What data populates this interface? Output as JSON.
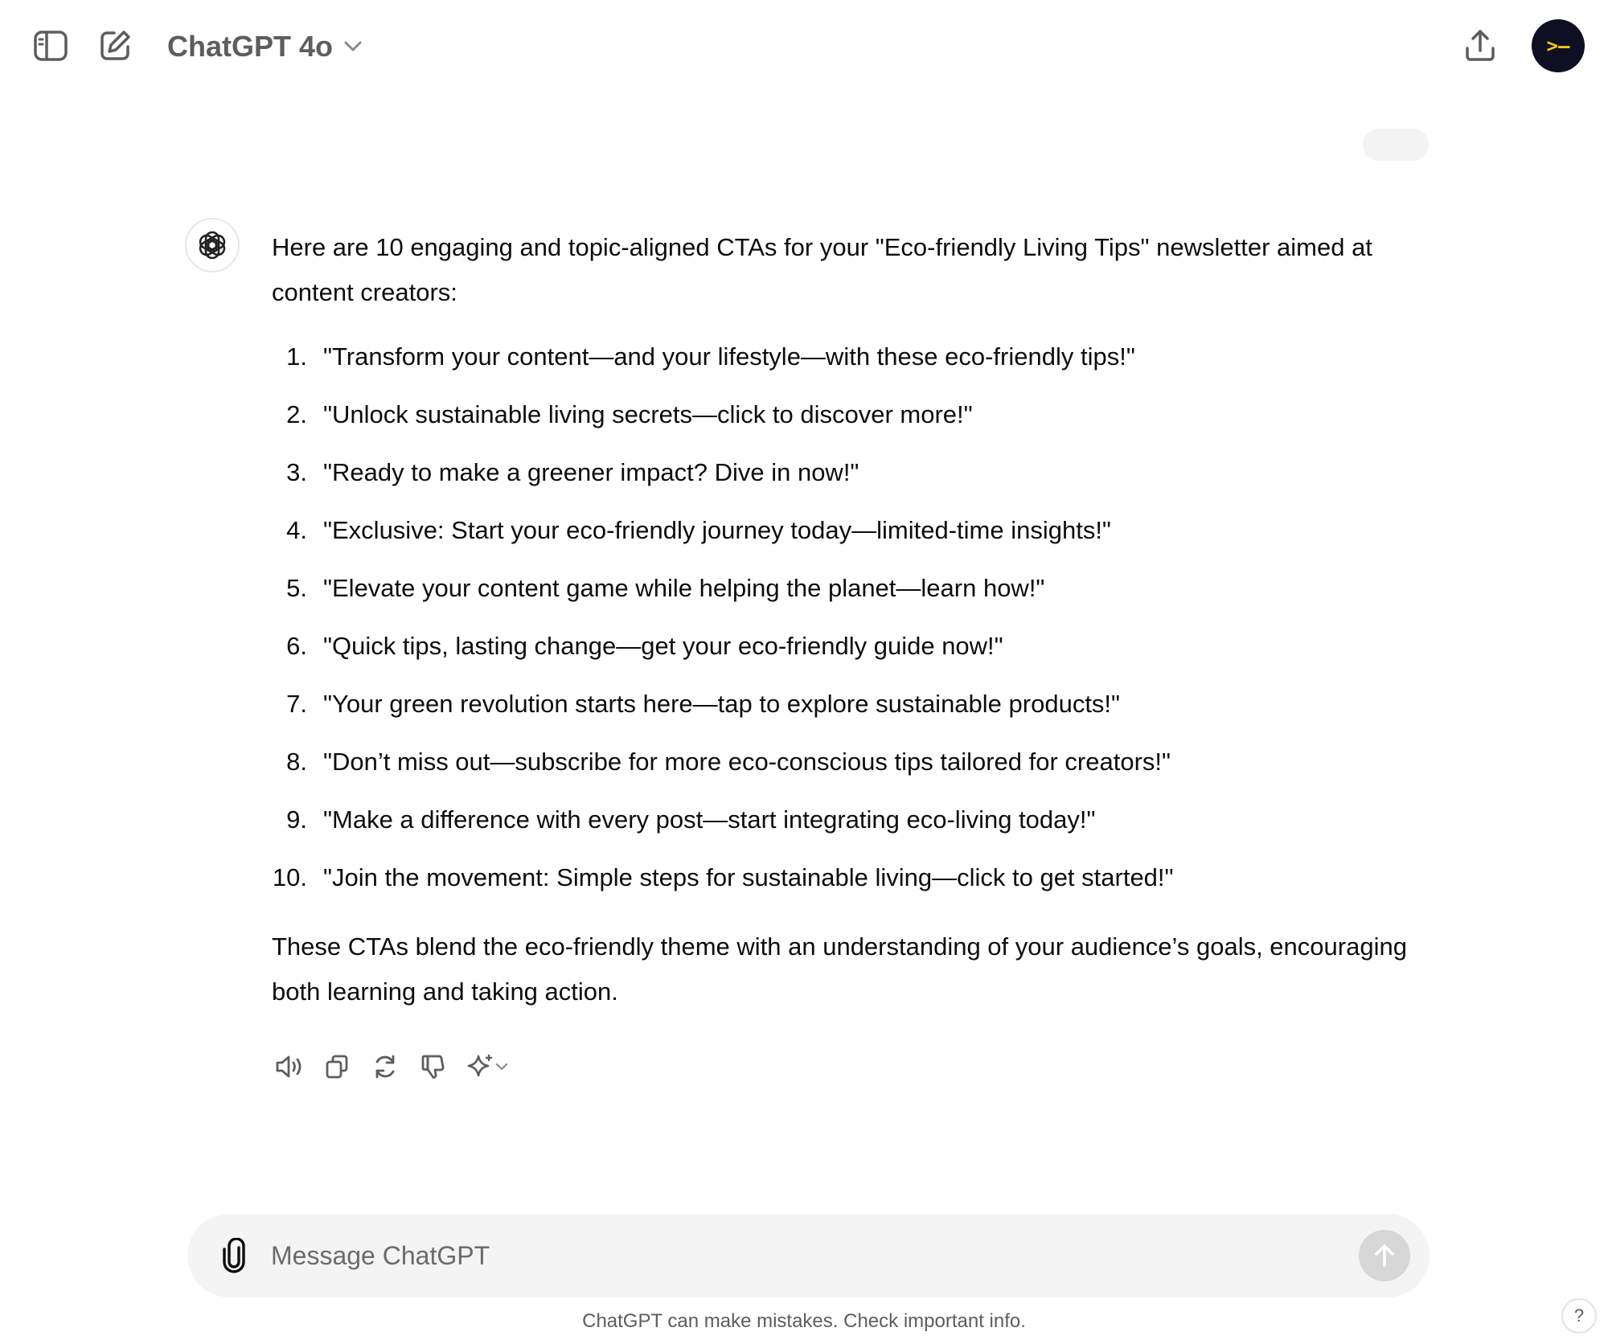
{
  "header": {
    "model_name": "ChatGPT 4o",
    "avatar_glyph": ">–",
    "avatar_color": "#0f0f23",
    "avatar_glyph_color": "#f5c518"
  },
  "assistant_message": {
    "intro": "Here are 10 engaging and topic-aligned CTAs for your \"Eco-friendly Living Tips\" newsletter aimed at content creators:",
    "ctas": [
      {
        "num": "1.",
        "text": "\"Transform your content—and your lifestyle—with these eco-friendly tips!\""
      },
      {
        "num": "2.",
        "text": "\"Unlock sustainable living secrets—click to discover more!\""
      },
      {
        "num": "3.",
        "text": "\"Ready to make a greener impact? Dive in now!\""
      },
      {
        "num": "4.",
        "text": "\"Exclusive: Start your eco-friendly journey today—limited-time insights!\""
      },
      {
        "num": "5.",
        "text": "\"Elevate your content game while helping the planet—learn how!\""
      },
      {
        "num": "6.",
        "text": "\"Quick tips, lasting change—get your eco-friendly guide now!\""
      },
      {
        "num": "7.",
        "text": "\"Your green revolution starts here—tap to explore sustainable products!\""
      },
      {
        "num": "8.",
        "text": "\"Don’t miss out—subscribe for more eco-conscious tips tailored for creators!\""
      },
      {
        "num": "9.",
        "text": "\"Make a difference with every post—start integrating eco-living today!\""
      },
      {
        "num": "10.",
        "text": "\"Join the movement: Simple steps for sustainable living—click to get started!\""
      }
    ],
    "outro": "These CTAs blend the eco-friendly theme with an understanding of your audience’s goals, encouraging both learning and taking action."
  },
  "composer": {
    "placeholder": "Message ChatGPT"
  },
  "footer": {
    "disclaimer": "ChatGPT can make mistakes. Check important info.",
    "help_label": "?"
  }
}
